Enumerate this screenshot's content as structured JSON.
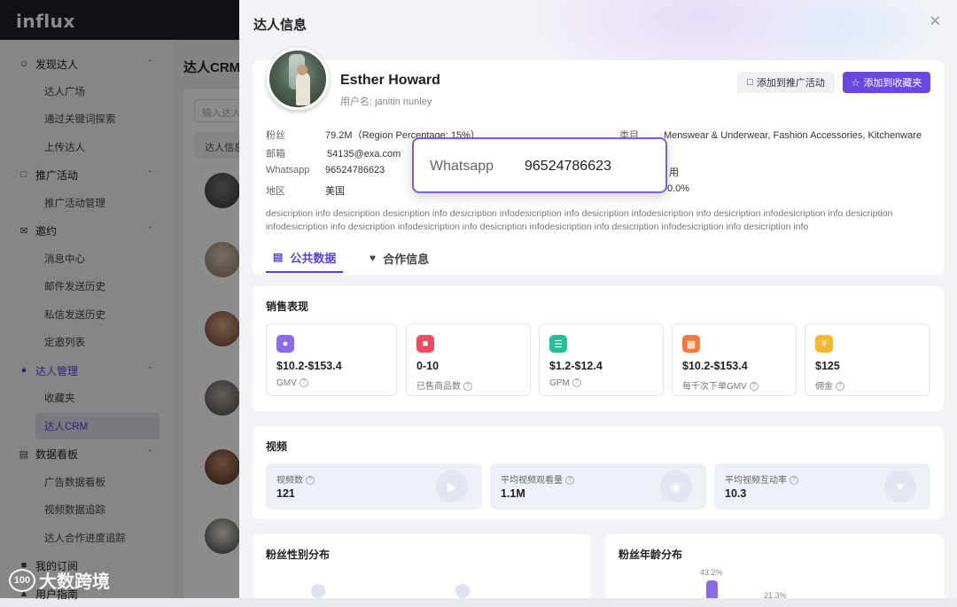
{
  "app": {
    "logo": "influx"
  },
  "sidebar": {
    "groups": [
      {
        "label": "发现达人",
        "icon": "person-search-icon",
        "items": [
          "达人广场",
          "通过关键词探索",
          "上传达人"
        ]
      },
      {
        "label": "推广活动",
        "icon": "megaphone-icon",
        "items": [
          "推广活动管理"
        ]
      },
      {
        "label": "邀约",
        "icon": "mail-icon",
        "items": [
          "消息中心",
          "邮件发送历史",
          "私信发送历史",
          "定邀列表"
        ]
      },
      {
        "label": "达人管理",
        "icon": "people-icon",
        "items": [
          "收藏夹",
          "达人CRM"
        ]
      },
      {
        "label": "数据看板",
        "icon": "document-icon",
        "items": [
          "广告数据看板",
          "视频数据追踪",
          "达人合作进度追踪"
        ]
      },
      {
        "label": "我的订阅",
        "icon": "subscription-icon",
        "items": []
      },
      {
        "label": "用户指南",
        "icon": "guide-icon",
        "items": []
      }
    ],
    "active_item": "达人CRM"
  },
  "crm": {
    "title": "达人CRM",
    "search_placeholder": "输入达人",
    "table_header": "达人信息"
  },
  "watermark": {
    "text": "大数跨境"
  },
  "drawer": {
    "title": "达人信息",
    "name": "Esther Howard",
    "username": "用户名: janitin nunley",
    "btn_promo": "添加到推广活动",
    "btn_fav": "添加到收藏夹",
    "info": {
      "fans_label": "粉丝",
      "fans_value": "79.2M（Region Percentage: 15%）",
      "email_label": "邮箱",
      "email_value": "54135@exa.com",
      "whatsapp_label": "Whatsapp",
      "whatsapp_value": "96524786623",
      "region_label": "地区",
      "region_value": "美国",
      "category_label": "类目",
      "category_value": "Menswear & Underwear, Fashion Accessories, Kitchenware",
      "partial_1": "用",
      "partial_2": "0.0%"
    },
    "description": "desicription info desicription  desicription info desicription infodesicription info desicription infodesicription info desicription infodesicription info desicription infodesicription info desicription infodesicription info desicription infodesicription info desicription infodesicription info desicription info",
    "tabs": [
      "公共数据",
      "合作信息"
    ]
  },
  "sales": {
    "title": "销售表现",
    "metrics": [
      {
        "value": "$10.2-$153.4",
        "label": "GMV",
        "color": "#8b6bea"
      },
      {
        "value": "0-10",
        "label": "已售商品数",
        "color": "#ef4a5e"
      },
      {
        "value": "$1.2-$12.4",
        "label": "GPM",
        "color": "#23c19a"
      },
      {
        "value": "$10.2-$153.4",
        "label": "每千次下单GMV",
        "color": "#f47a3a"
      },
      {
        "value": "$125",
        "label": "佣金",
        "color": "#f5b82e"
      }
    ]
  },
  "video": {
    "title": "视频",
    "stats": [
      {
        "label": "视频数",
        "value": "121",
        "icon": "play-icon"
      },
      {
        "label": "平均视频观看量",
        "value": "1.1M",
        "icon": "eye-icon"
      },
      {
        "label": "平均视频互动率",
        "value": "10.3",
        "icon": "heart-icon"
      }
    ]
  },
  "gender": {
    "title": "粉丝性别分布"
  },
  "age": {
    "title": "粉丝年龄分布",
    "bar1_label": "43.2%",
    "bar1_value": 43.2,
    "bar2_label": "21.3%"
  },
  "tooltip": {
    "label": "Whatsapp",
    "value": "96524786623"
  }
}
